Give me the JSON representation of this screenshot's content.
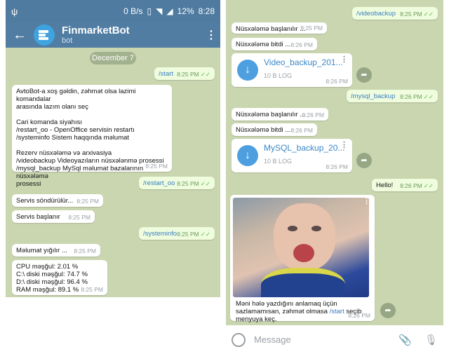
{
  "left": {
    "status": {
      "left_icon": "usb-icon",
      "speed": "0 B/s",
      "battery": "12%",
      "clock": "8:28"
    },
    "header": {
      "back_icon": "arrow-left-icon",
      "title": "FinmarketBot",
      "subtitle": "bot",
      "menu_icon": "more-vertical-icon"
    },
    "date_chip": "December 7",
    "messages": [
      {
        "text": "/start",
        "time": "8:25 PM"
      },
      {
        "lines": [
          "AvtoBot-a xoş gəldin, zəhmət olsa lazimi komandalar",
          "arasında lazım olanı seç",
          "",
          "Cari komanda siyahısı",
          "/restart_oo - OpenOffice servisin restartı",
          "/systeminfo Sistem haqqında məlumat",
          "",
          "Rezerv nüsxələmə və arxivasiya",
          "/videobackup Videoyazıların nüsxələnmə prosessi",
          "/mysql_backup MySql məlumat bazalarının nüsxələmə",
          "prosessi"
        ],
        "time": "8:25 PM"
      },
      {
        "text": "/restart_oo",
        "time": "8:25 PM"
      },
      {
        "text": "Servis söndürülür...",
        "time": "8:25 PM"
      },
      {
        "text": "Servis başlanır",
        "time": "8:25 PM"
      },
      {
        "text": "/systeminfo",
        "time": "8:25 PM"
      },
      {
        "text": "Məlumat yığılır ...",
        "time": "8:25 PM"
      },
      {
        "lines": [
          "CPU məşğul: 2.01 %",
          "C:\\ diski məşğul: 74.7 %",
          "D:\\ diski məşğul: 96.4 %",
          "RAM məşğul: 89.1 %"
        ],
        "time": "8:25 PM"
      }
    ]
  },
  "right": {
    "messages": [
      {
        "text": "/videobackup",
        "time": "8:25 PM"
      },
      {
        "text": "Nüsxələmə başlanılır ...",
        "time": "8:25 PM"
      },
      {
        "text": "Nüsxələmə bitdi ...",
        "time": "8:26 PM"
      },
      {
        "file_name": "Video_backup_201...",
        "file_size": "10 B LOG",
        "time": "8:26 PM"
      },
      {
        "text": "/mysql_backup",
        "time": "8:26 PM"
      },
      {
        "text": "Nüsxələmə başlanılır ...",
        "time": "8:26 PM"
      },
      {
        "text": "Nüsxələmə bitdi ...",
        "time": "8:26 PM"
      },
      {
        "file_name": "MySQL_backup_20...",
        "file_size": "10 B LOG",
        "time": "8:26 PM"
      },
      {
        "text": "Hello!",
        "time": "8:26 PM"
      },
      {
        "caption_1": "Məni hələ yazdığını anlamaq üçün",
        "caption_2": "sazlamamısan, zəhmət olmasa",
        "cmd": "/start",
        "caption_3": "seçib",
        "caption_4": "menyuya keç.",
        "time": "8:26 PM"
      }
    ],
    "input": {
      "placeholder": "Message"
    }
  },
  "colors": {
    "header": "#517da2",
    "chat_bg": "#c9d6b0",
    "outgoing": "#effdde",
    "link": "#3a7bc0"
  }
}
